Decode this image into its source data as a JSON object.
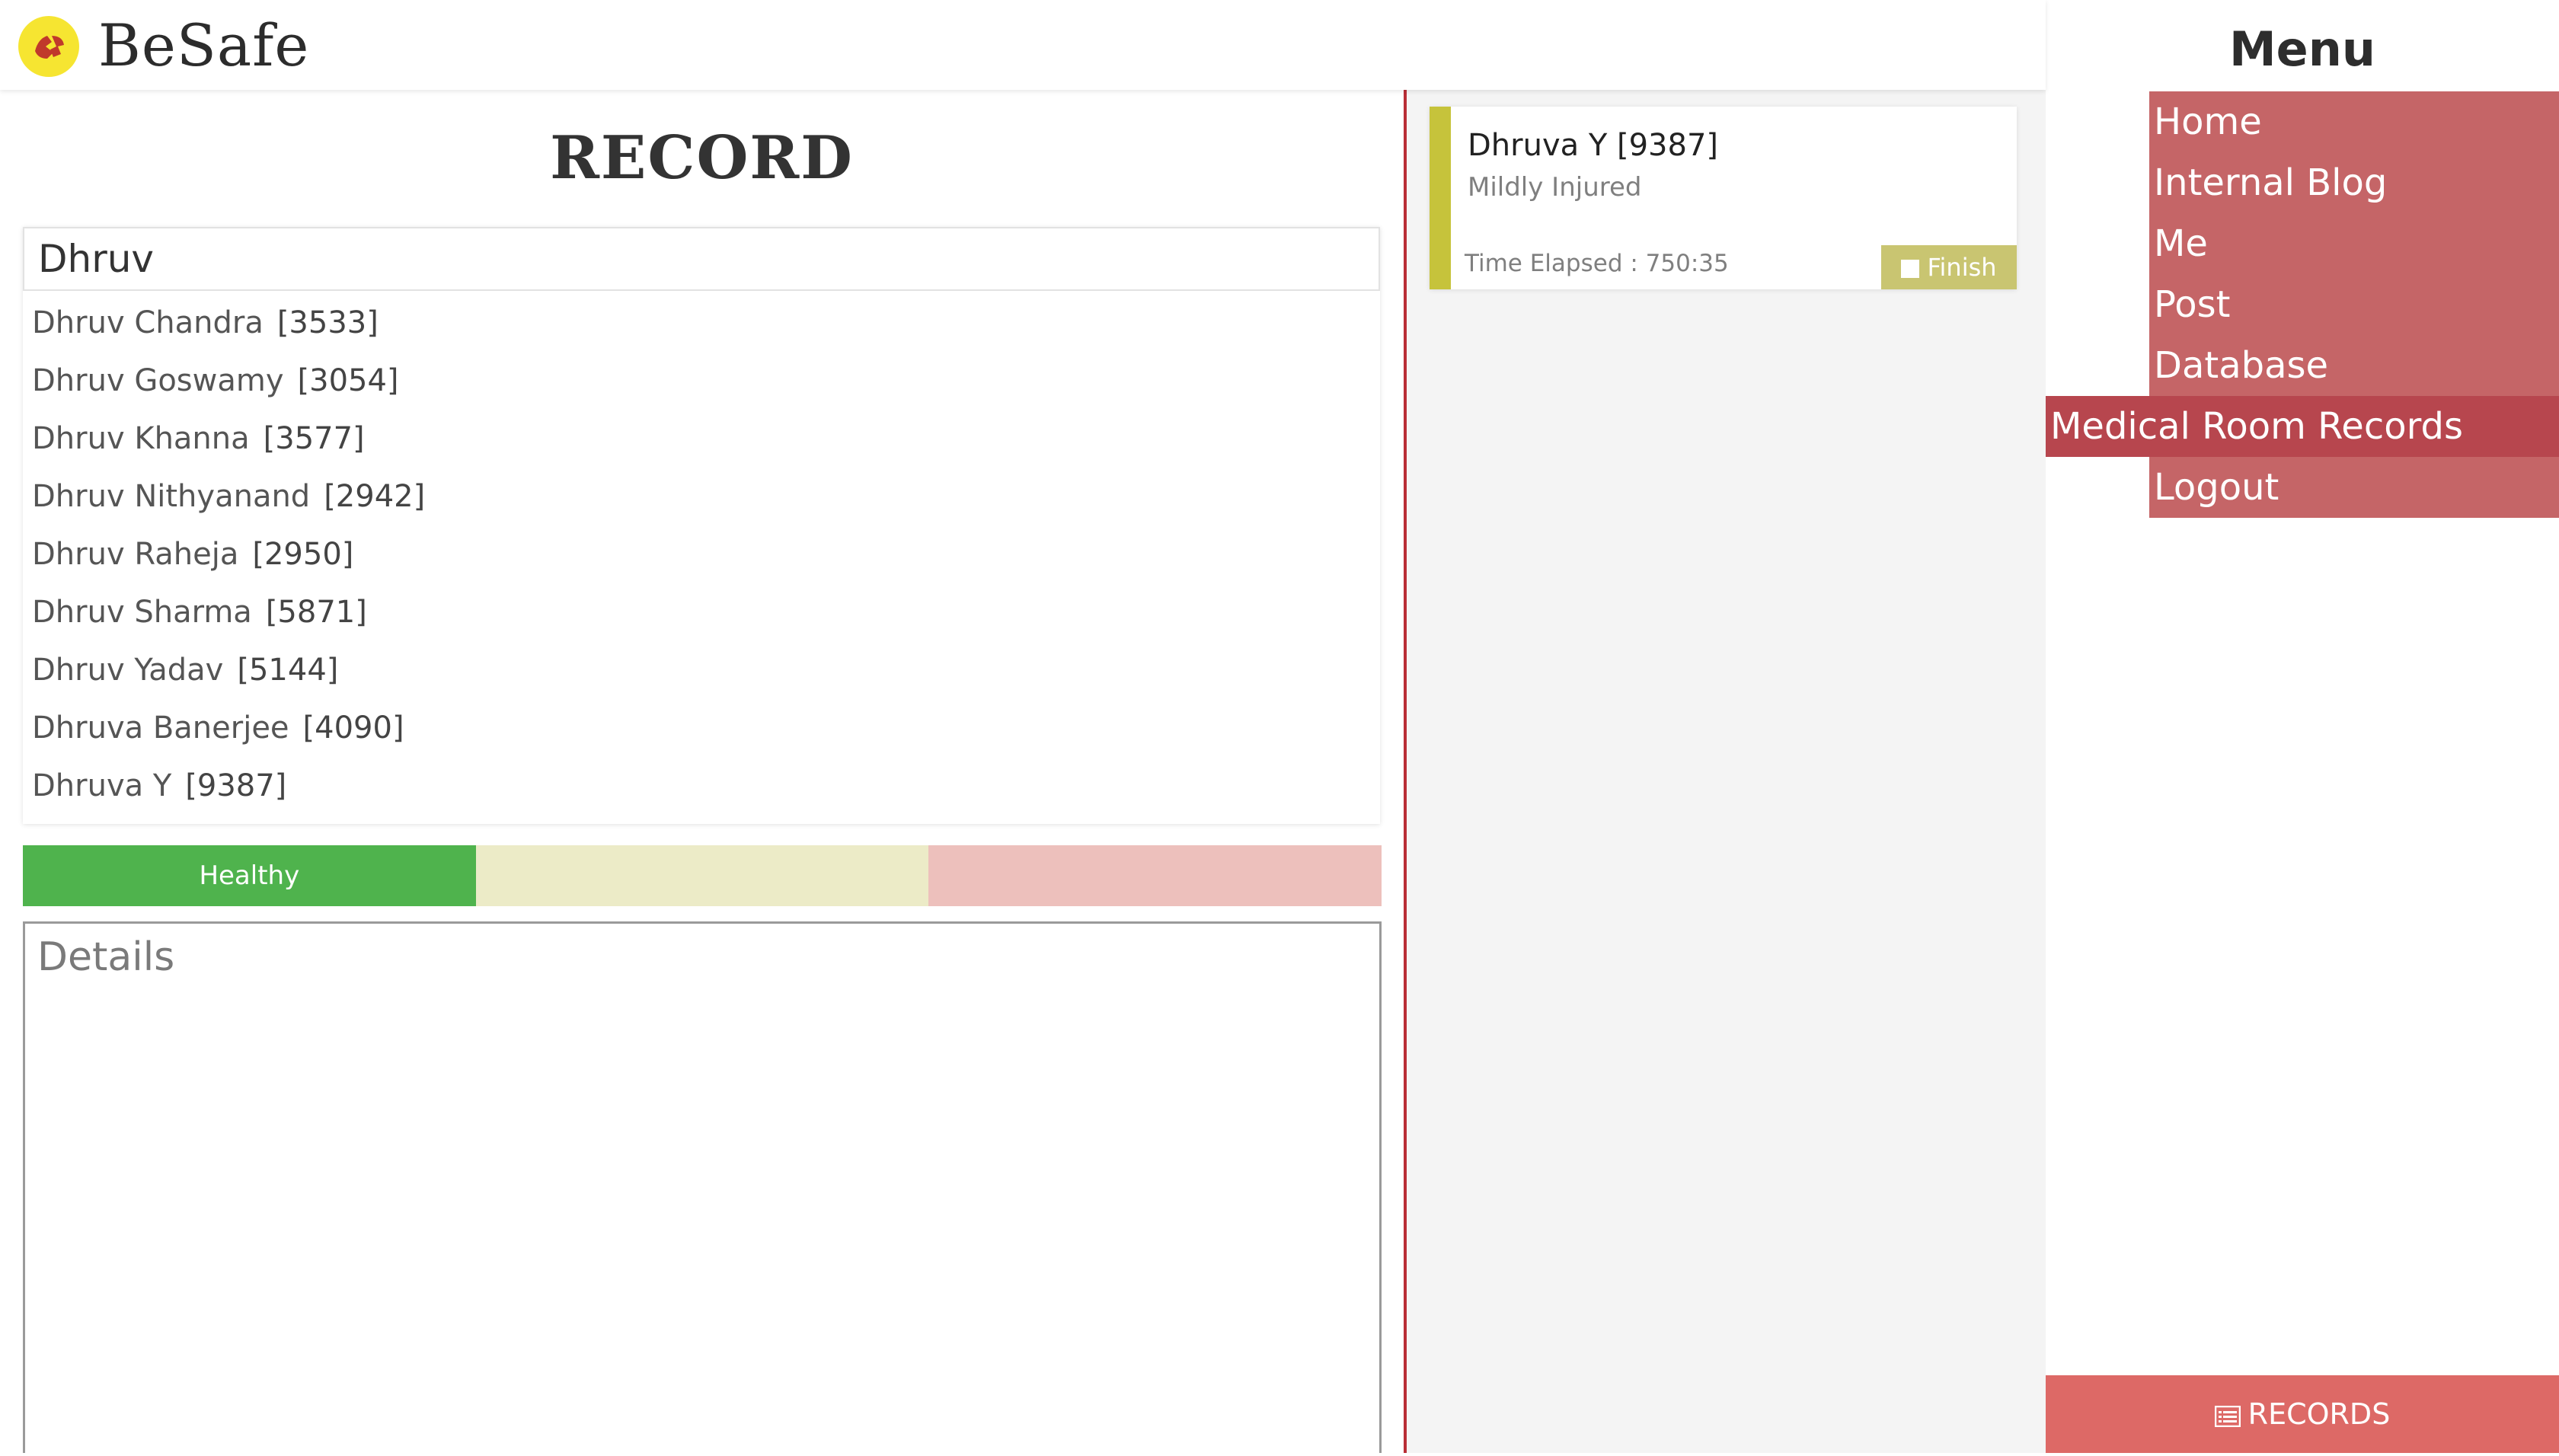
{
  "app": {
    "brand": "BeSafe"
  },
  "record": {
    "title": "RECORD",
    "search_value": "Dhruv",
    "suggestions": [
      {
        "name": "Dhruv Chandra",
        "id": "[3533]"
      },
      {
        "name": "Dhruv Goswamy",
        "id": "[3054]"
      },
      {
        "name": "Dhruv Khanna",
        "id": "[3577]"
      },
      {
        "name": "Dhruv Nithyanand",
        "id": "[2942]"
      },
      {
        "name": "Dhruv Raheja",
        "id": "[2950]"
      },
      {
        "name": "Dhruv Sharma",
        "id": "[5871]"
      },
      {
        "name": "Dhruv Yadav",
        "id": "[5144]"
      },
      {
        "name": "Dhruva Banerjee",
        "id": "[4090]"
      },
      {
        "name": "Dhruva Y",
        "id": "[9387]"
      }
    ],
    "status_options": [
      "Healthy",
      "",
      ""
    ],
    "details_placeholder": "Details"
  },
  "active": {
    "card": {
      "name": "Dhruva Y [9387]",
      "status": "Mildly Injured",
      "time": "Time Elapsed : 750:35",
      "finish_label": "Finish"
    }
  },
  "menu": {
    "title": "Menu",
    "items": [
      "Home",
      "Internal Blog",
      "Me",
      "Post",
      "Database",
      "Medical Room Records",
      "Logout"
    ],
    "active_index": 5,
    "records_button": "RECORDS"
  },
  "colors": {
    "accent_red": "#b92e36",
    "menu_item": "#c56567",
    "menu_active": "#b7464e",
    "healthy": "#4fb34d",
    "mild": "#ecebc7",
    "severe": "#edc0bc",
    "card_stripe": "#c6c33b",
    "records_button": "#dd6966"
  },
  "icons": {
    "logo": "besafe-logo-icon",
    "finish": "square-icon",
    "records": "list-icon"
  }
}
